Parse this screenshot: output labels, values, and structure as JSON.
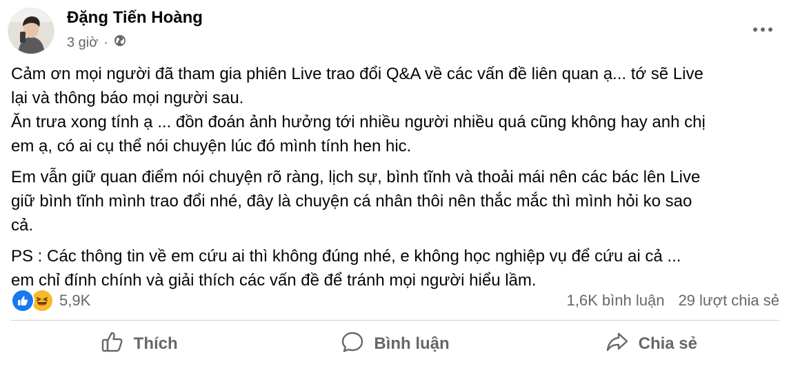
{
  "post": {
    "author": "Đặng Tiến Hoàng",
    "time": "3 giờ",
    "separator": "·",
    "paragraphs": [
      "Cảm ơn mọi người đã tham gia phiên Live trao đổi Q&A về các vấn đề liên quan ạ... tớ sẽ Live\nlại và thông báo mọi người sau.\nĂn trưa xong tính ạ ... đồn đoán ảnh hưởng tới nhiều người nhiều quá cũng không hay anh chị\nem ạ, có ai cụ thể nói chuyện lúc đó mình tính hen hic.",
      "Em vẫn giữ quan điểm nói chuyện rõ ràng, lịch sự, bình tĩnh và thoải mái nên các bác lên Live\ngiữ bình tĩnh mình trao đổi nhé, đây là chuyện cá nhân thôi nên thắc mắc thì mình hỏi ko sao\ncả.",
      "PS : Các thông tin về em cứu ai thì không đúng nhé, e không học nghiệp vụ để cứu ai cả ...\nem chỉ đính chính và giải thích các vấn đề để tránh mọi người hiểu lầm."
    ]
  },
  "stats": {
    "reaction_count": "5,9K",
    "comments": "1,6K bình luận",
    "shares": "29 lượt chia sẻ",
    "reaction_icons": [
      "like-icon",
      "haha-icon"
    ]
  },
  "actions": {
    "like": "Thích",
    "comment": "Bình luận",
    "share": "Chia sẻ"
  },
  "colors": {
    "like_blue": "#1877f2",
    "haha_yellow": "#f7b928",
    "secondary_text": "#65676b"
  }
}
